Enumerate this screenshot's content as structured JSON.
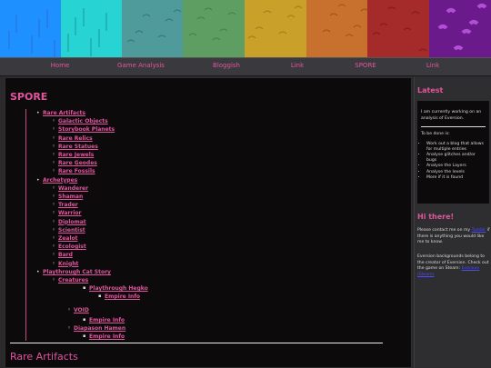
{
  "banner": {
    "bands": [
      {
        "color": "#1e90ff",
        "motif": "#2a6fd0"
      },
      {
        "color": "#27d3d3",
        "motif": "#1a9a9a"
      },
      {
        "color": "#4f9a9a",
        "motif": "#3b7373"
      },
      {
        "color": "#5e9e62",
        "motif": "#4a7d4e"
      },
      {
        "color": "#c9a12a",
        "motif": "#a07d1c"
      },
      {
        "color": "#c8702e",
        "motif": "#9c521d"
      },
      {
        "color": "#a52a2a",
        "motif": "#7d1c1c"
      },
      {
        "color": "#6a1a8a",
        "motif": "#b24fd6"
      }
    ]
  },
  "nav": {
    "items": [
      {
        "label": "Home"
      },
      {
        "label": "Game Analysis"
      },
      {
        "label": "Bloggish"
      },
      {
        "label": "Link"
      },
      {
        "label": "SPORE"
      },
      {
        "label": "Link"
      }
    ]
  },
  "main": {
    "title": "SPORE",
    "toc": {
      "rare_artifacts": {
        "label": "Rare Artifacts",
        "children": [
          "Galactic Objects",
          "Storybook Planets",
          "Rare Relics",
          "Rare Statues",
          "Rare Jewels",
          "Rare Geodes",
          "Rare Fossils"
        ]
      },
      "archetypes": {
        "label": "Archetypes",
        "children": [
          "Wanderer",
          "Shaman",
          "Trader",
          "Warrior",
          "Diplomat",
          "Scientist",
          "Zealot",
          "Ecologist",
          "Bard",
          "Knight"
        ]
      },
      "playthrough": {
        "label": "Playthrough Cat Story",
        "creatures": "Creatures",
        "hegko": "Playthrough Hegko",
        "empire_info_1": "Empire Info",
        "void": "VOID",
        "empire_info_2": "Empire Info",
        "diapason": "Diapason Hamen",
        "empire_info_3": "Empire Info"
      }
    },
    "section_title": "Rare Artifacts"
  },
  "sidebar": {
    "latest_title": "Latest",
    "latest_intro": "I am currently working on an analysis of Eversion.",
    "todo_title": "To be done is:",
    "todo": [
      "Work out a blog that allows for multiple entries",
      "Analyse glitches and/or bugs",
      "Analyse the Layers",
      "Analyse the levels",
      "More if it is found"
    ],
    "hi_title": "Hi there!",
    "contact_pre": "Please contact me on my",
    "contact_link": "Tumblr",
    "contact_post": "if there is anything you would like me to know.",
    "credit_text": "Eversion backgrounds belong to the creator of Eversion. Check out the game on Steam:",
    "credit_link": "Eversion (Steam)"
  },
  "colors": {
    "accent": "#e0559e",
    "bg_dark": "#0c0a0b",
    "bg_side": "#2e2e30"
  }
}
